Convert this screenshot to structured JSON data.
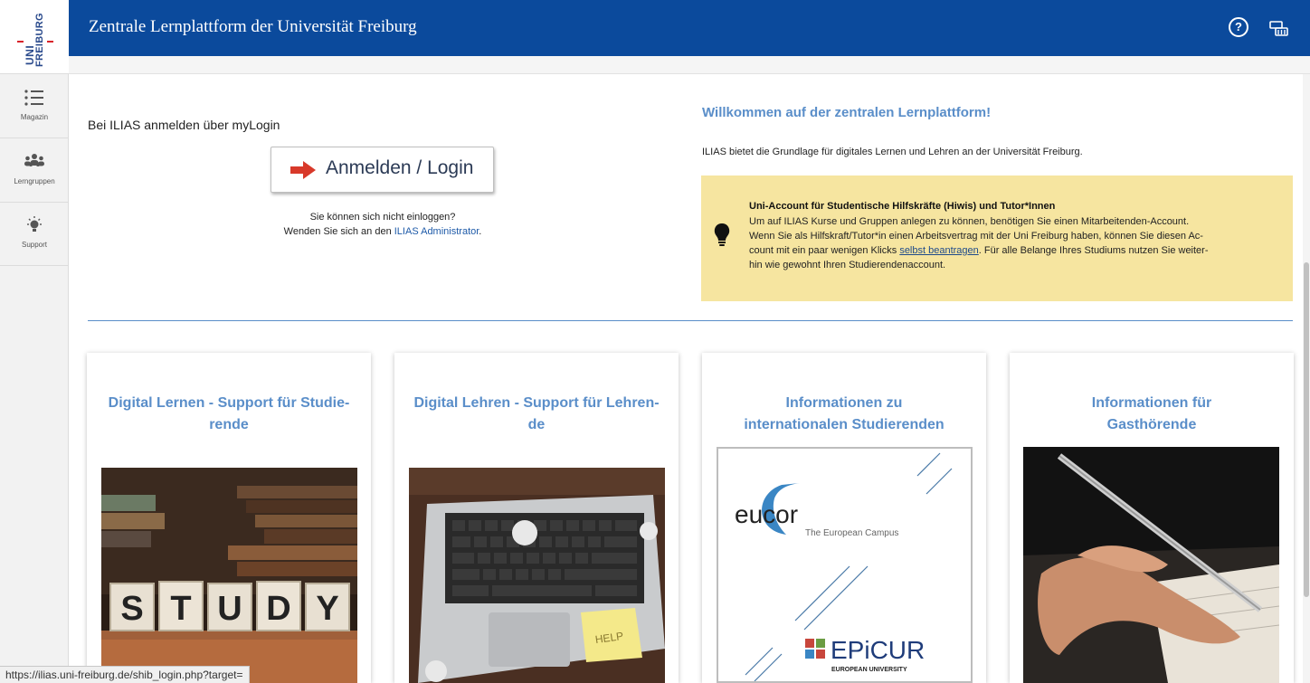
{
  "logo": {
    "line1": "UNI",
    "line2": "FREIBURG"
  },
  "sidebar": {
    "items": [
      {
        "label": "Magazin",
        "icon": "list-icon"
      },
      {
        "label": "Lerngruppen",
        "icon": "group-icon"
      },
      {
        "label": "Support",
        "icon": "lightbulb-icon"
      }
    ]
  },
  "header": {
    "title": "Zentrale Lernplattform der Universität Freiburg",
    "help_glyph": "?",
    "notification_icon": "notification-center-icon"
  },
  "login": {
    "label": "Bei ILIAS anmelden über myLogin",
    "button_label": "Anmelden / Login",
    "cant_login": "Sie können sich nicht einloggen?",
    "contact_prefix": "Wenden Sie sich an den",
    "contact_link": "ILIAS Administrator",
    "contact_suffix": "."
  },
  "welcome": {
    "title": "Willkommen auf der zentralen Lernplattform!",
    "intro": "ILIAS bietet die Grundlage für digitales Lernen und Lehren an der Universität Freiburg."
  },
  "notice": {
    "title": "Uni-Account für Studentische Hilfskräfte (Hiwis) und Tutor*Innen",
    "line1": "Um auf ILIAS Kurse und Gruppen anlegen zu können, benötigen Sie einen Mitarbeitenden-Account.",
    "line2": "Wenn Sie als Hilfskraft/Tutor*in einen Arbeitsvertrag mit der Uni Freiburg haben, können Sie diesen Ac-",
    "line3_pre": "count mit ein paar wenigen Klicks",
    "line3_link": "selbst beantragen",
    "line3_post": ". Für alle Belange Ihres Studiums nutzen Sie weiter-",
    "line4": "hin wie gewohnt Ihren Studierendenaccount.",
    "colors": {
      "background": "#f6e5a0"
    }
  },
  "cards": [
    {
      "title_l1": "Digital Lernen - Support für Studie-",
      "title_l2": "rende",
      "image_text": "STUDY"
    },
    {
      "title_l1": "Digital Lehren - Support für Lehren-",
      "title_l2": "de",
      "image_text": "HELP"
    },
    {
      "title_l1": "Informationen zu",
      "title_l2": "internationalen Studierenden",
      "image_text_1": "eucor",
      "image_text_2": "The European Campus",
      "image_text_3": "EPiCUR",
      "image_text_4": "EUROPEAN UNIVERSITY"
    },
    {
      "title_l1": "Informationen für",
      "title_l2": "Gasthörende"
    }
  ],
  "status_url": "https://ilias.uni-freiburg.de/shib_login.php?target=",
  "colors": {
    "header": "#0b4a9c",
    "accent": "#5a8ec9",
    "brand_red": "#d8232a"
  }
}
